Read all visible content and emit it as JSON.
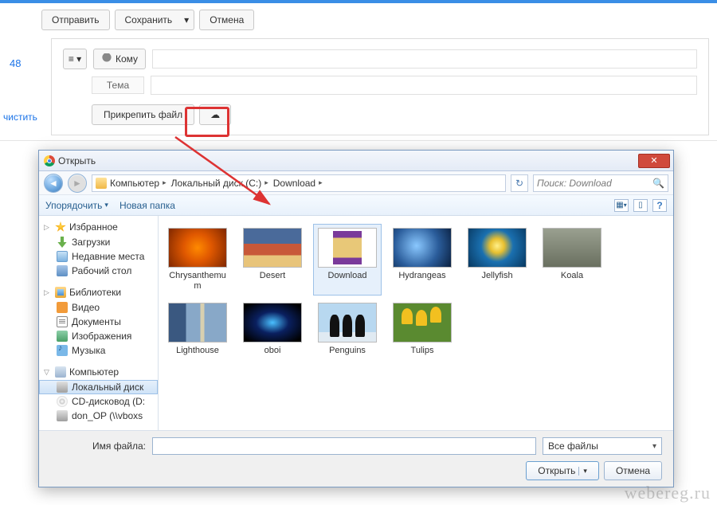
{
  "compose": {
    "send": "Отправить",
    "save": "Сохранить",
    "cancel": "Отмена",
    "to_label": "Кому",
    "subject_label": "Тема",
    "attach_label": "Прикрепить файл"
  },
  "left": {
    "count": "48",
    "clear": "чистить"
  },
  "dialog": {
    "title": "Открыть",
    "breadcrumb": [
      "Компьютер",
      "Локальный диск (C:)",
      "Download"
    ],
    "search_placeholder": "Поиск: Download",
    "toolbar": {
      "organize": "Упорядочить",
      "new_folder": "Новая папка"
    },
    "sidebar": {
      "favorites": "Избранное",
      "downloads": "Загрузки",
      "recent": "Недавние места",
      "desktop": "Рабочий стол",
      "libraries": "Библиотеки",
      "videos": "Видео",
      "documents": "Документы",
      "pictures": "Изображения",
      "music": "Музыка",
      "computer": "Компьютер",
      "localdisk": "Локальный диск",
      "cd": "CD-дисковод (D:",
      "don": "don_OP (\\\\vboxs"
    },
    "files": [
      {
        "name": "Chrysanthemum",
        "thumb": "th-chrys"
      },
      {
        "name": "Desert",
        "thumb": "th-desert"
      },
      {
        "name": "Download",
        "thumb": "th-rar",
        "sel": true
      },
      {
        "name": "Hydrangeas",
        "thumb": "th-hydra"
      },
      {
        "name": "Jellyfish",
        "thumb": "th-jelly"
      },
      {
        "name": "Koala",
        "thumb": "th-koala"
      },
      {
        "name": "Lighthouse",
        "thumb": "th-light"
      },
      {
        "name": "oboi",
        "thumb": "th-oboi"
      },
      {
        "name": "Penguins",
        "thumb": "th-peng"
      },
      {
        "name": "Tulips",
        "thumb": "th-tulip"
      }
    ],
    "filename_label": "Имя файла:",
    "filename_value": "",
    "filter": "Все файлы",
    "open_btn": "Открыть",
    "cancel_btn": "Отмена"
  },
  "watermark": "webereg.ru"
}
